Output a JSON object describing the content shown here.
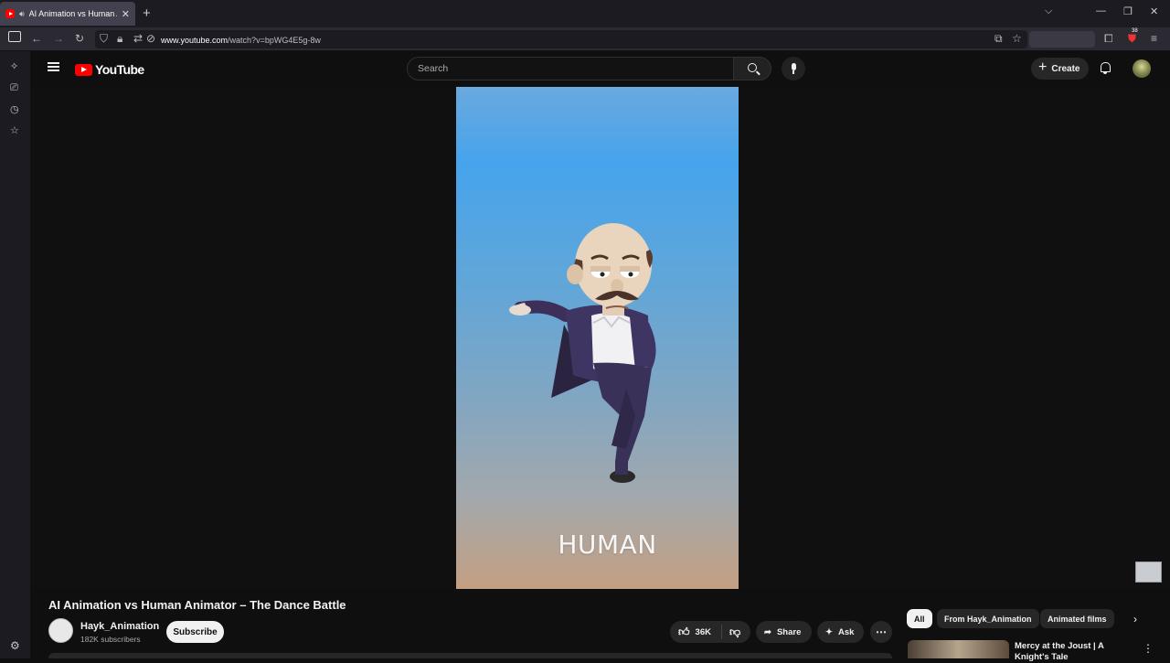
{
  "browser": {
    "tab_title": "AI Animation vs Human Animator – The Dance Battle",
    "tab_sound_icon": "speaker-icon",
    "url_host": "www.youtube.com",
    "url_path": "/watch?v=bpWG4E5g-8w",
    "extension_badge": "38"
  },
  "youtube": {
    "logo_text": "YouTube",
    "search_placeholder": "Search",
    "create_label": "Create",
    "brand_color": "#ff0000"
  },
  "video": {
    "overlay_text": "HUMAN",
    "title": "AI Animation vs Human Animator – The Dance Battle"
  },
  "channel": {
    "name": "Hayk_Animation",
    "subscribers": "182K subscribers",
    "subscribe_label": "Subscribe"
  },
  "actions": {
    "likes": "36K",
    "share_label": "Share",
    "ask_label": "Ask"
  },
  "chips": [
    "All",
    "From Hayk_Animation",
    "Animated films"
  ],
  "recommendation": {
    "title": "Mercy at the Joust | A Knight's Tale"
  }
}
